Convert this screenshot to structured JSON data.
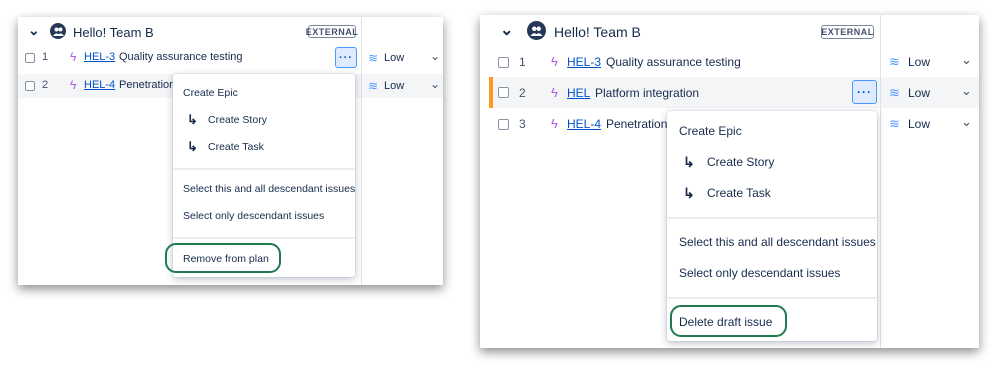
{
  "left": {
    "team": {
      "name": "Hello! Team B",
      "badge": "EXTERNAL"
    },
    "rows": [
      {
        "num": "1",
        "key": "HEL-3",
        "summary": "Quality assurance testing",
        "priority": "Low"
      },
      {
        "num": "2",
        "key": "HEL-4",
        "summary": "Penetration",
        "priority": "Low"
      }
    ],
    "menu": {
      "create_epic": "Create Epic",
      "create_story": "Create Story",
      "create_task": "Create Task",
      "select_all": "Select this and all descendant issues",
      "select_only": "Select only descendant issues",
      "remove": "Remove from plan"
    }
  },
  "right": {
    "team": {
      "name": "Hello! Team B",
      "badge": "EXTERNAL"
    },
    "rows": [
      {
        "num": "1",
        "key": "HEL-3",
        "summary": "Quality assurance testing",
        "priority": "Low"
      },
      {
        "num": "2",
        "key": "HEL",
        "summary": "Platform integration",
        "priority": "Low"
      },
      {
        "num": "3",
        "key": "HEL-4",
        "summary": "Penetration",
        "priority": "Low"
      }
    ],
    "menu": {
      "create_epic": "Create Epic",
      "create_story": "Create Story",
      "create_task": "Create Task",
      "select_all": "Select this and all descendant issues",
      "select_only": "Select only descendant issues",
      "delete": "Delete draft issue"
    }
  },
  "icons": {
    "collapse": "chevron-down-icon",
    "team": "team-avatar-icon",
    "epic": "epic-lightning-icon",
    "priority": "priority-low-icon",
    "more": "more-actions-icon",
    "subtask": "child-arrow-icon"
  },
  "colors": {
    "highlight_ring": "#1f7a4f",
    "link": "#0052cc",
    "draft_bar": "#ff991f",
    "epic": "#b05fe0"
  },
  "glyphs": {
    "chevron": "⌄",
    "epic": "ϟ",
    "low": "≋",
    "more": "···",
    "sub": "↳"
  }
}
